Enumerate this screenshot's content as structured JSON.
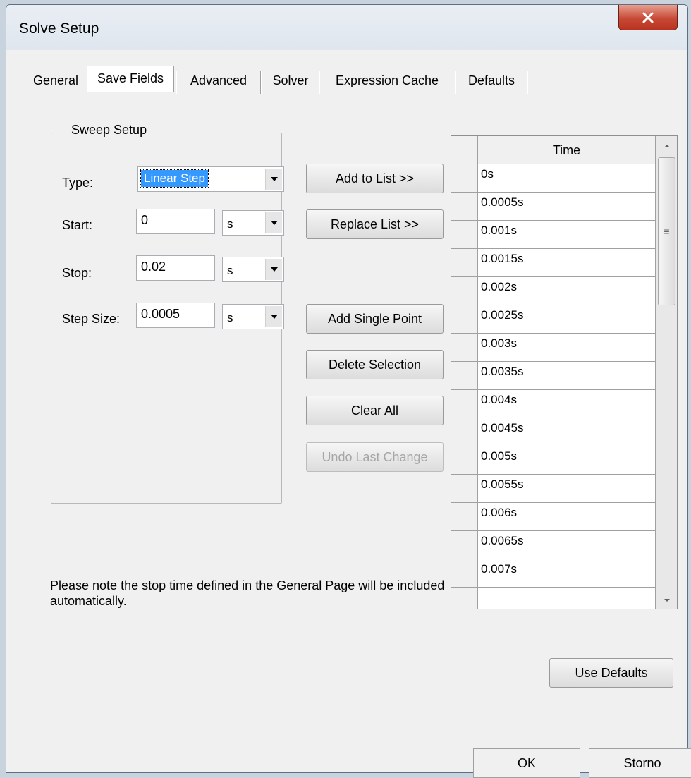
{
  "window": {
    "title": "Solve Setup"
  },
  "tabs": [
    "General",
    "Save Fields",
    "Advanced",
    "Solver",
    "Expression Cache",
    "Defaults"
  ],
  "sweep": {
    "title": "Sweep Setup",
    "type_label": "Type:",
    "type_value": "Linear Step",
    "start_label": "Start:",
    "start_value": "0",
    "start_unit": "s",
    "stop_label": "Stop:",
    "stop_value": "0.02",
    "stop_unit": "s",
    "step_label": "Step Size:",
    "step_value": "0.0005",
    "step_unit": "s"
  },
  "buttons": {
    "add_to_list": "Add to List >>",
    "replace_list": "Replace List >>",
    "add_single_point": "Add Single Point",
    "delete_selection": "Delete Selection",
    "clear_all": "Clear All",
    "undo_last_change": "Undo Last Change",
    "use_defaults": "Use Defaults",
    "ok": "OK",
    "cancel": "Storno"
  },
  "note": "Please note the stop time defined in the General Page will be included automatically.",
  "grid": {
    "column": "Time",
    "rows": [
      "0s",
      "0.0005s",
      "0.001s",
      "0.0015s",
      "0.002s",
      "0.0025s",
      "0.003s",
      "0.0035s",
      "0.004s",
      "0.0045s",
      "0.005s",
      "0.0055s",
      "0.006s",
      "0.0065s",
      "0.007s",
      ""
    ]
  }
}
